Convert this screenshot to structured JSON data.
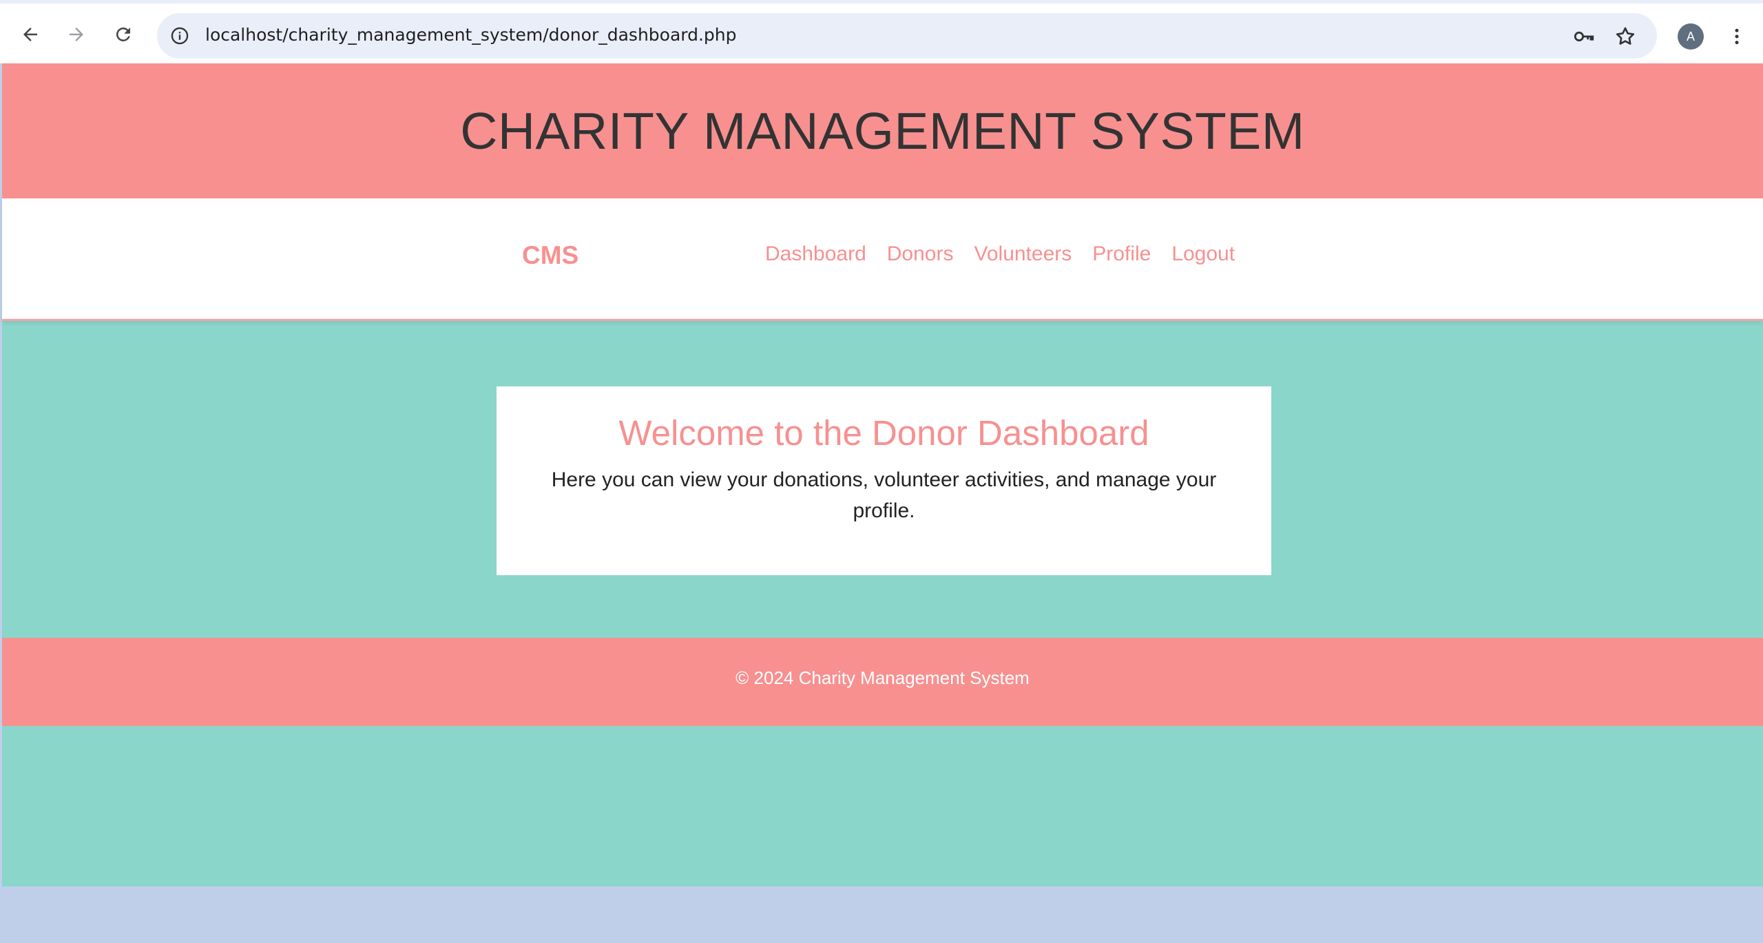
{
  "browser": {
    "url": "localhost/charity_management_system/donor_dashboard.php",
    "profile_initial": "A",
    "icons": {
      "back": "arrow-left-icon",
      "forward": "arrow-right-icon",
      "reload": "reload-icon",
      "site_info": "info-icon",
      "passwords": "key-icon",
      "bookmark": "star-icon",
      "menu": "more-vert-icon"
    }
  },
  "header": {
    "title": "CHARITY MANAGEMENT SYSTEM"
  },
  "navbar": {
    "brand": "CMS",
    "links": [
      "Dashboard",
      "Donors",
      "Volunteers",
      "Profile",
      "Logout"
    ]
  },
  "welcome": {
    "heading": "Welcome to the Donor Dashboard",
    "text": "Here you can view your donations, volunteer activities, and manage your profile."
  },
  "footer": {
    "text": "© 2024 Charity Management System"
  },
  "colors": {
    "accent": "#f89090",
    "page_background": "#8ad6ca",
    "card_background": "#ffffff",
    "heading_text": "#333333",
    "below_page": "#c0cfe9"
  }
}
